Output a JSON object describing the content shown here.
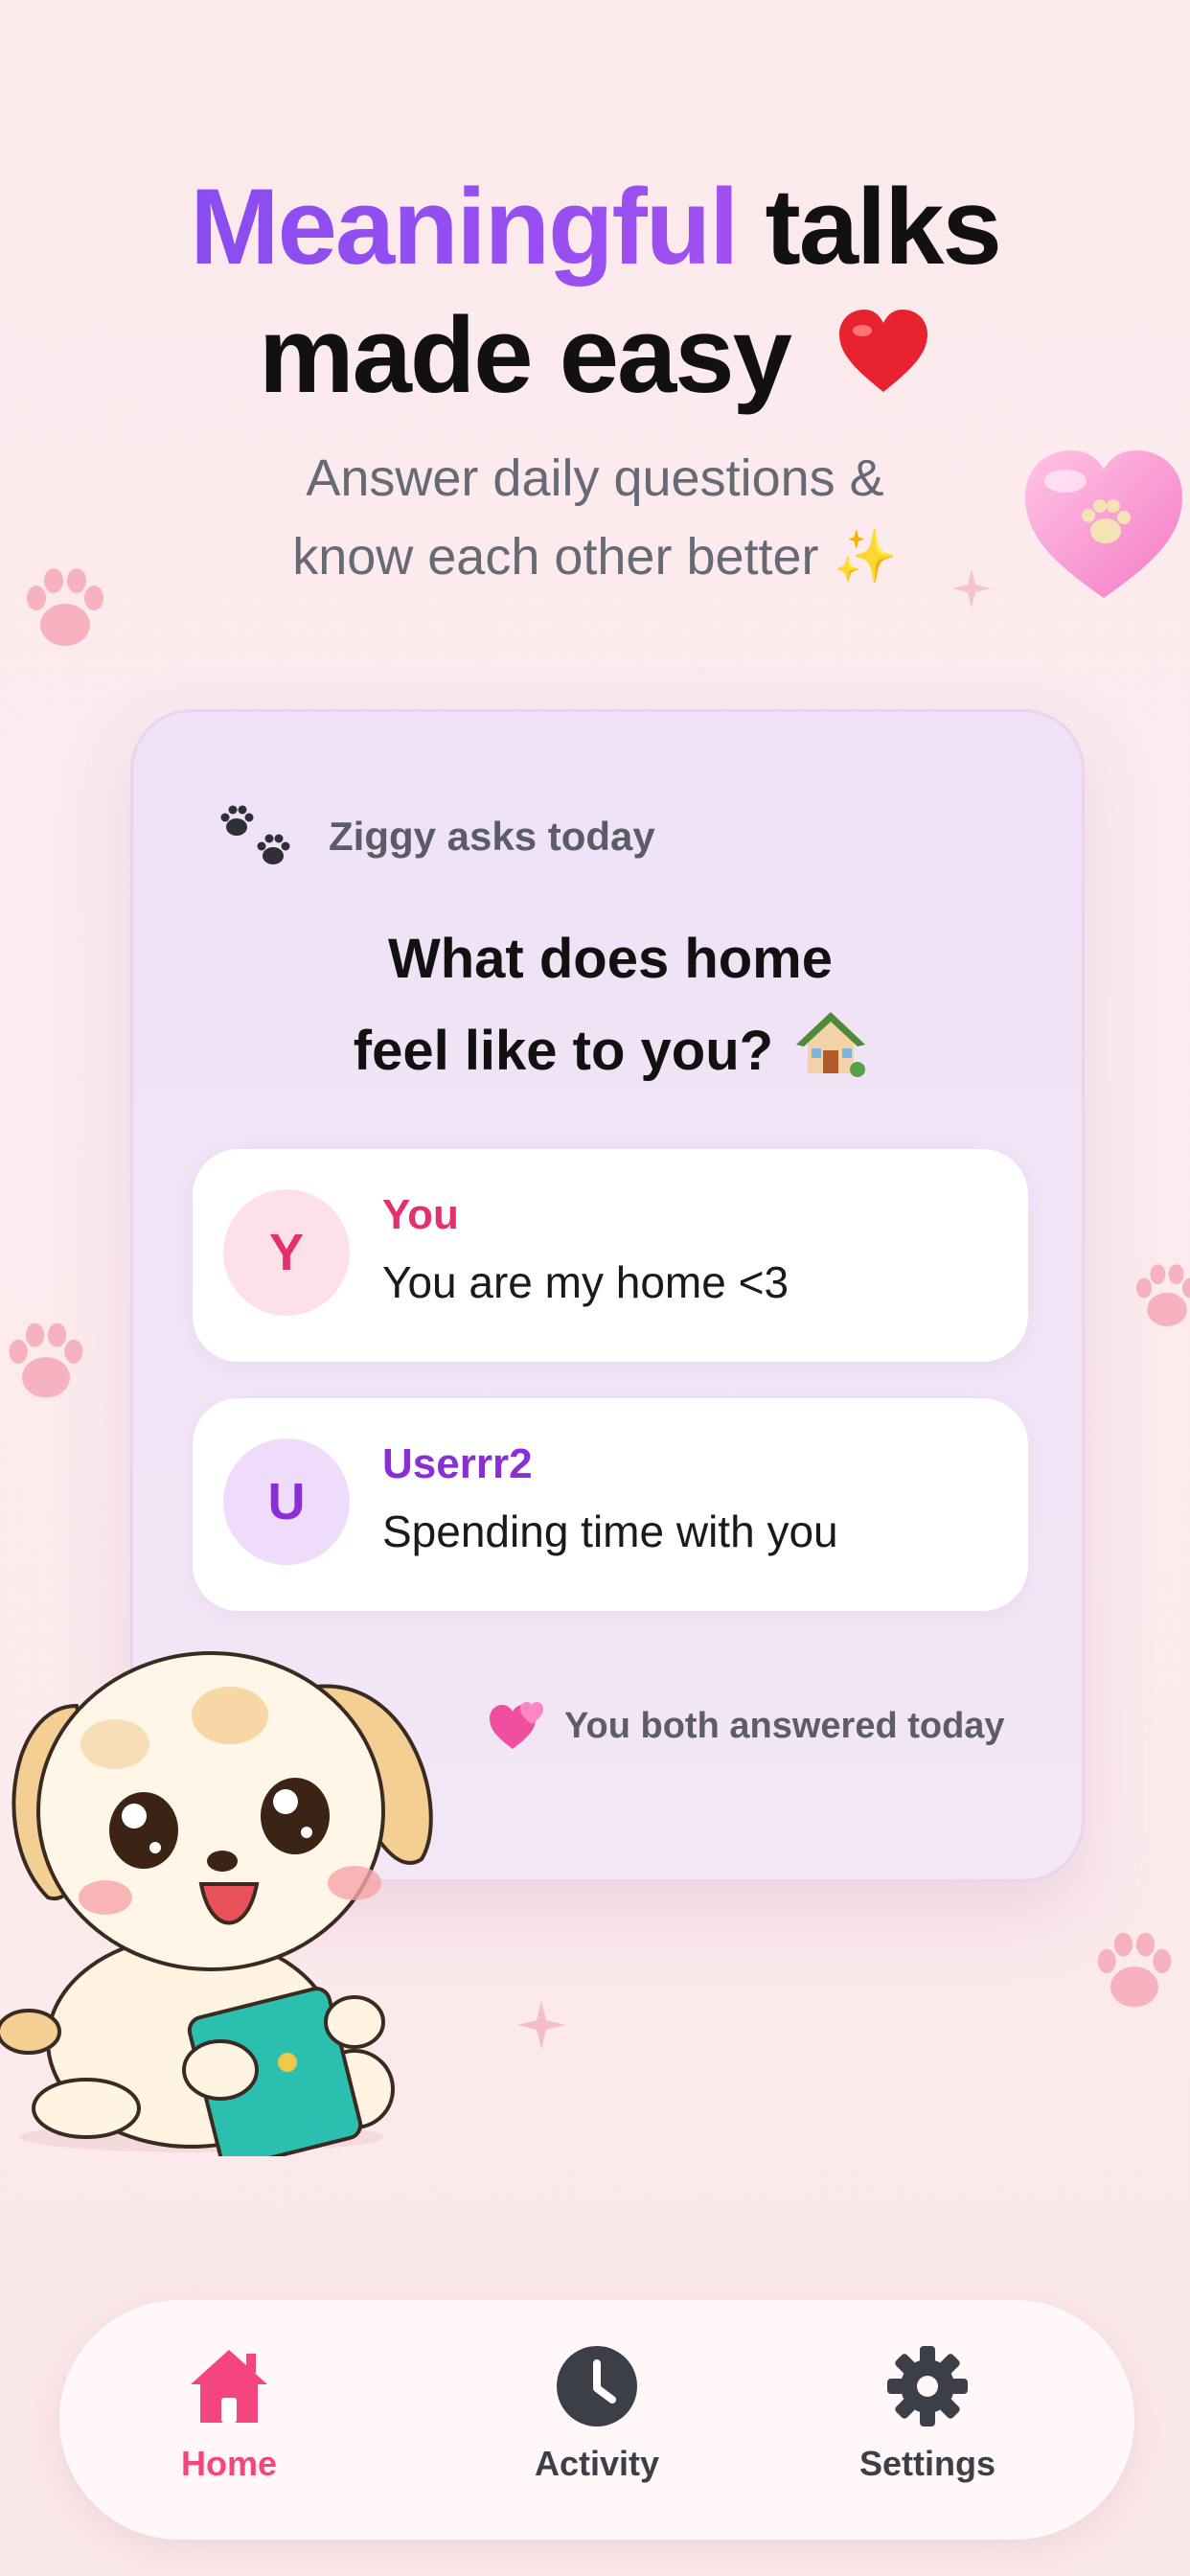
{
  "headline": {
    "accent": "Meaningful",
    "rest_line1": " talks",
    "line2": "made easy"
  },
  "subtitle": {
    "line1": "Answer daily questions &",
    "line2": "know each other better ✨"
  },
  "card": {
    "header_label": "Ziggy asks today",
    "question_line1": "What does home",
    "question_line2": "feel like to you?",
    "answers": [
      {
        "initial": "Y",
        "name": "You",
        "text": "You are my home <3",
        "name_color": "#e4306e",
        "avatar_bg": "#fde0e8"
      },
      {
        "initial": "U",
        "name": "Userrr2",
        "text": "Spending time with you",
        "name_color": "#8a2fd6",
        "avatar_bg": "#efdcfa"
      }
    ],
    "status": "You both answered today"
  },
  "tabs": [
    {
      "label": "Home",
      "icon": "home-icon",
      "active": true
    },
    {
      "label": "Activity",
      "icon": "clock-icon",
      "active": false
    },
    {
      "label": "Settings",
      "icon": "gear-icon",
      "active": false
    }
  ],
  "colors": {
    "accent_purple": "#8a4cf0",
    "active_tab": "#f4457f",
    "inactive_tab": "#3d3f48"
  }
}
